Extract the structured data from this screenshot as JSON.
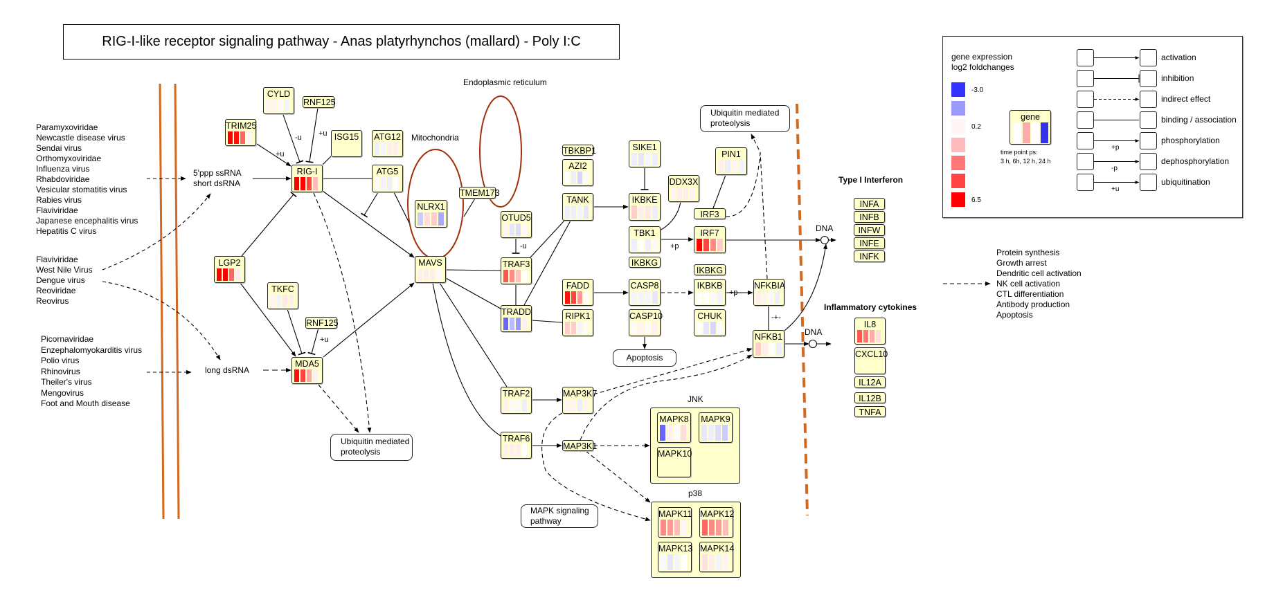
{
  "title": "RIG-I-like receptor signaling pathway - Anas platyrhynchos (mallard) - Poly I:C",
  "compartments": {
    "er": "Endoplasmic reticulum",
    "mito": "Mitochondria"
  },
  "virus_groups": [
    [
      "Paramyxoviridae",
      "Newcastle disease virus",
      "Sendai virus",
      "Orthomyxoviridae",
      "Influenza virus",
      "Rhabdoviridae",
      "Vesicular stomatitis virus",
      "Rabies virus",
      "Flaviviridae",
      "Japanese encephalitis virus",
      "Hepatitis C virus"
    ],
    [
      "Flaviviridae",
      "West Nile Virus",
      "Dengue virus",
      "Reoviridae",
      "Reovirus"
    ],
    [
      "Picornaviridae",
      "Enzephalomyokarditis virus",
      "Polio virus",
      "Rhinovirus",
      "Theiler's virus",
      "Mengovirus",
      "Foot and Mouth disease"
    ]
  ],
  "ligands": {
    "ssrna_1": "5'ppp ssRNA",
    "ssrna_2": "short dsRNA",
    "long": "long dsRNA"
  },
  "pathway_links": {
    "ubiq_left_1": "Ubiquitin mediated",
    "ubiq_left_2": "proteolysis",
    "ubiq_top_1": "Ubiquitin mediated",
    "ubiq_top_2": "proteolysis",
    "apoptosis": "Apoptosis",
    "mapk_1": "MAPK signaling",
    "mapk_2": "pathway"
  },
  "groups": {
    "jnk": "JNK",
    "p38": "p38"
  },
  "section_labels": {
    "ifn": "Type I Interferon",
    "cyto": "Inflammatory cytokines",
    "dna1": "DNA",
    "dna2": "DNA"
  },
  "outcomes": [
    "Protein synthesis",
    "Growth arrest",
    "Dendritic cell activation",
    "NK cell activation",
    "CTL differentiation",
    "Antibody production",
    "Apoptosis"
  ],
  "edge_labels": [
    "+u",
    "-u",
    "+u",
    "+u",
    "-u",
    "+p",
    "+p",
    "-+-"
  ],
  "nodes": [
    {
      "label": "CYLD",
      "expression": [
        "#fff3f3",
        "#fff3f3",
        "#fffafa",
        "#f3f3ff"
      ]
    },
    {
      "label": "RNF125",
      "expression": null
    },
    {
      "label": "TRIM25",
      "expression": [
        "#ff0000",
        "#ff1010",
        "#ff6666",
        "#fff5f5"
      ]
    },
    {
      "label": "ISG15",
      "expression": null
    },
    {
      "label": "ATG12",
      "expression": [
        "#eeeeff",
        "#f5f5ff",
        "#ffeeee",
        "#ffeeee"
      ]
    },
    {
      "label": "RIG-I",
      "expression": [
        "#ff0000",
        "#ff0000",
        "#ff4444",
        "#ffbbbb"
      ]
    },
    {
      "label": "ATG5",
      "expression": [
        "#fffafa",
        "#f3f3ff",
        "#eeeeff",
        "#ffffff"
      ]
    },
    {
      "label": "NLRX1",
      "expression": [
        "#ccccff",
        "#ffdddd",
        "#ffcccc",
        "#aaaaff"
      ]
    },
    {
      "label": "TMEM173",
      "expression": null
    },
    {
      "label": "MAVS",
      "expression": [
        "#ffeeee",
        "#ffeeee",
        "#ffeeee",
        "#fff8f8"
      ]
    },
    {
      "label": "LGP2",
      "expression": [
        "#ff0000",
        "#ff0000",
        "#ff6666",
        "#ffeeee"
      ]
    },
    {
      "label": "TKFC",
      "expression": [
        "#fff3f3",
        "#f3f3ff",
        "#ffe8e8",
        "#ffeeee"
      ]
    },
    {
      "label": "RNF125",
      "expression": null
    },
    {
      "label": "MDA5",
      "expression": [
        "#ff1111",
        "#ff4444",
        "#ffaaaa",
        "#fff0f0"
      ]
    },
    {
      "label": "OTUD5",
      "expression": [
        "#fff3f3",
        "#e6e6ff",
        "#ddddff",
        "#fffafa"
      ]
    },
    {
      "label": "TRAF3",
      "expression": [
        "#ff5555",
        "#ff8888",
        "#ffc0c0",
        "#ffffff"
      ]
    },
    {
      "label": "TRADD",
      "expression": [
        "#6666ff",
        "#bbbbff",
        "#9999ff",
        "#fff0f0"
      ]
    },
    {
      "label": "TBKBP1",
      "expression": null
    },
    {
      "label": "AZI2",
      "expression": [
        "#ffffff",
        "#eeeeff",
        "#d6d6ff",
        "#fafaff"
      ]
    },
    {
      "label": "TANK",
      "expression": [
        "#eeeeff",
        "#eeeeff",
        "#f3f3ff",
        "#e6e6ff"
      ]
    },
    {
      "label": "FADD",
      "expression": [
        "#ff1111",
        "#ff4444",
        "#ff9999",
        "#ffffff"
      ]
    },
    {
      "label": "RIPK1",
      "expression": [
        "#ffcccc",
        "#ffcccc",
        "#f3f3ff",
        "#fffafa"
      ]
    },
    {
      "label": "SIKE1",
      "expression": [
        "#eeeeff",
        "#e6e6ff",
        "#f5f5ff",
        "#eeeeff"
      ]
    },
    {
      "label": "IKBKE",
      "expression": [
        "#ffcccc",
        "#ffeeee",
        "#ffe8e8",
        "#eeeeff"
      ]
    },
    {
      "label": "DDX3X",
      "expression": [
        "#fff3f3",
        "#ffeeee",
        "#ffeeee",
        "#fff3f3"
      ]
    },
    {
      "label": "TBK1",
      "expression": [
        "#eeeeff",
        "#ffffff",
        "#eeeeff",
        "#fffafa"
      ]
    },
    {
      "label": "IKBKG",
      "expression": null
    },
    {
      "label": "CASP8",
      "expression": [
        "#f5f5ff",
        "#f5f5ff",
        "#f5f5ff",
        "#e6e6ff"
      ]
    },
    {
      "label": "CASP10",
      "expression": [
        "#fffafa",
        "#fff3f3",
        "#fffafa",
        "#fff0f0"
      ]
    },
    {
      "label": "PIN1",
      "expression": [
        "#fff0f0",
        "#eeeeff",
        "#fff3f3",
        "#f3f3ff"
      ]
    },
    {
      "label": "IRF3",
      "expression": null
    },
    {
      "label": "IRF7",
      "expression": [
        "#ff0000",
        "#ff4444",
        "#ff8888",
        "#ffcccc"
      ]
    },
    {
      "label": "IKBKG",
      "expression": null
    },
    {
      "label": "IKBKB",
      "expression": [
        "#ffffff",
        "#ffffff",
        "#fafaff",
        "#f3f3ff"
      ]
    },
    {
      "label": "CHUK",
      "expression": [
        "#ffffff",
        "#e6e6ff",
        "#d6d6ff",
        "#fafaff"
      ]
    },
    {
      "label": "NFKBIA",
      "expression": [
        "#ffeeee",
        "#fff3f3",
        "#f8f8ff",
        "#eeeeff"
      ]
    },
    {
      "label": "NFKB1",
      "expression": [
        "#ffcccc",
        "#ffeeee",
        "#ffffff",
        "#eeeeff"
      ]
    },
    {
      "label": "TRAF2",
      "expression": [
        "#fff0f0",
        "#fffafa",
        "#f8f8ff",
        "#eeeeff"
      ]
    },
    {
      "label": "MAP3K7",
      "expression": [
        "#fff3f3",
        "#fff3f3",
        "#eeeeff",
        "#fff3f3"
      ]
    },
    {
      "label": "TRAF6",
      "expression": [
        "#fff0f0",
        "#ffeeee",
        "#ffeeee",
        "#ffffff"
      ]
    },
    {
      "label": "MAP3K1",
      "expression": null
    },
    {
      "label": "MAPK8",
      "expression": [
        "#6666ff",
        "#fff0f0",
        "#fafaff",
        "#ffdddd"
      ]
    },
    {
      "label": "MAPK9",
      "expression": [
        "#e6e6ff",
        "#eeeeff",
        "#ddddff",
        "#ccccff"
      ]
    },
    {
      "label": "MAPK10",
      "expression": null
    },
    {
      "label": "MAPK11",
      "expression": [
        "#ff8888",
        "#ff9999",
        "#ffbbbb",
        "#fff5f5"
      ]
    },
    {
      "label": "MAPK12",
      "expression": [
        "#ff6666",
        "#ff8888",
        "#ff9999",
        "#ffbbbb"
      ]
    },
    {
      "label": "MAPK13",
      "expression": [
        "#f8f8ff",
        "#e6e6ff",
        "#f5f5ff",
        "#ffffff"
      ]
    },
    {
      "label": "MAPK14",
      "expression": [
        "#ffe0e0",
        "#ffeeee",
        "#f3f3ff",
        "#fff3f3"
      ]
    },
    {
      "label": "INFA",
      "expression": null
    },
    {
      "label": "INFB",
      "expression": null
    },
    {
      "label": "INFW",
      "expression": null
    },
    {
      "label": "INFE",
      "expression": null
    },
    {
      "label": "INFK",
      "expression": null
    },
    {
      "label": "IL8",
      "expression": [
        "#ff5555",
        "#ff7777",
        "#ffaaaa",
        "#ffdddd"
      ]
    },
    {
      "label": "CXCL10",
      "expression": null
    },
    {
      "label": "IL12A",
      "expression": null
    },
    {
      "label": "IL12B",
      "expression": null
    },
    {
      "label": "TNFA",
      "expression": null
    }
  ],
  "legend": {
    "title_1": "gene expression",
    "title_2": "log2 foldchanges",
    "scale_colors": [
      "#3333ff",
      "#9999ff",
      "#fff5f5",
      "#ffbbbb",
      "#ff7777",
      "#ff4444",
      "#ff0000"
    ],
    "scale_min": "-3.0",
    "scale_mid": "0.2",
    "scale_max": "6.5",
    "example_gene": "gene",
    "example_colors": [
      "#ffffff",
      "#ffaaaa",
      "#ffffff",
      "#3333ee"
    ],
    "time_1": "time point ps:",
    "time_2": "3 h, 6h, 12 h, 24 h",
    "relations": [
      {
        "label": "activation",
        "mark": ""
      },
      {
        "label": "inhibition",
        "mark": ""
      },
      {
        "label": "indirect effect",
        "mark": ""
      },
      {
        "label": "binding / association",
        "mark": ""
      },
      {
        "label": "phosphorylation",
        "mark": "+p"
      },
      {
        "label": "dephosphorylation",
        "mark": "-p"
      },
      {
        "label": "ubiquitination",
        "mark": "+u"
      }
    ]
  },
  "colors": {
    "node_fill": "#ffffcc",
    "membrane": "#d2691e",
    "organelle": "#a0300a"
  }
}
